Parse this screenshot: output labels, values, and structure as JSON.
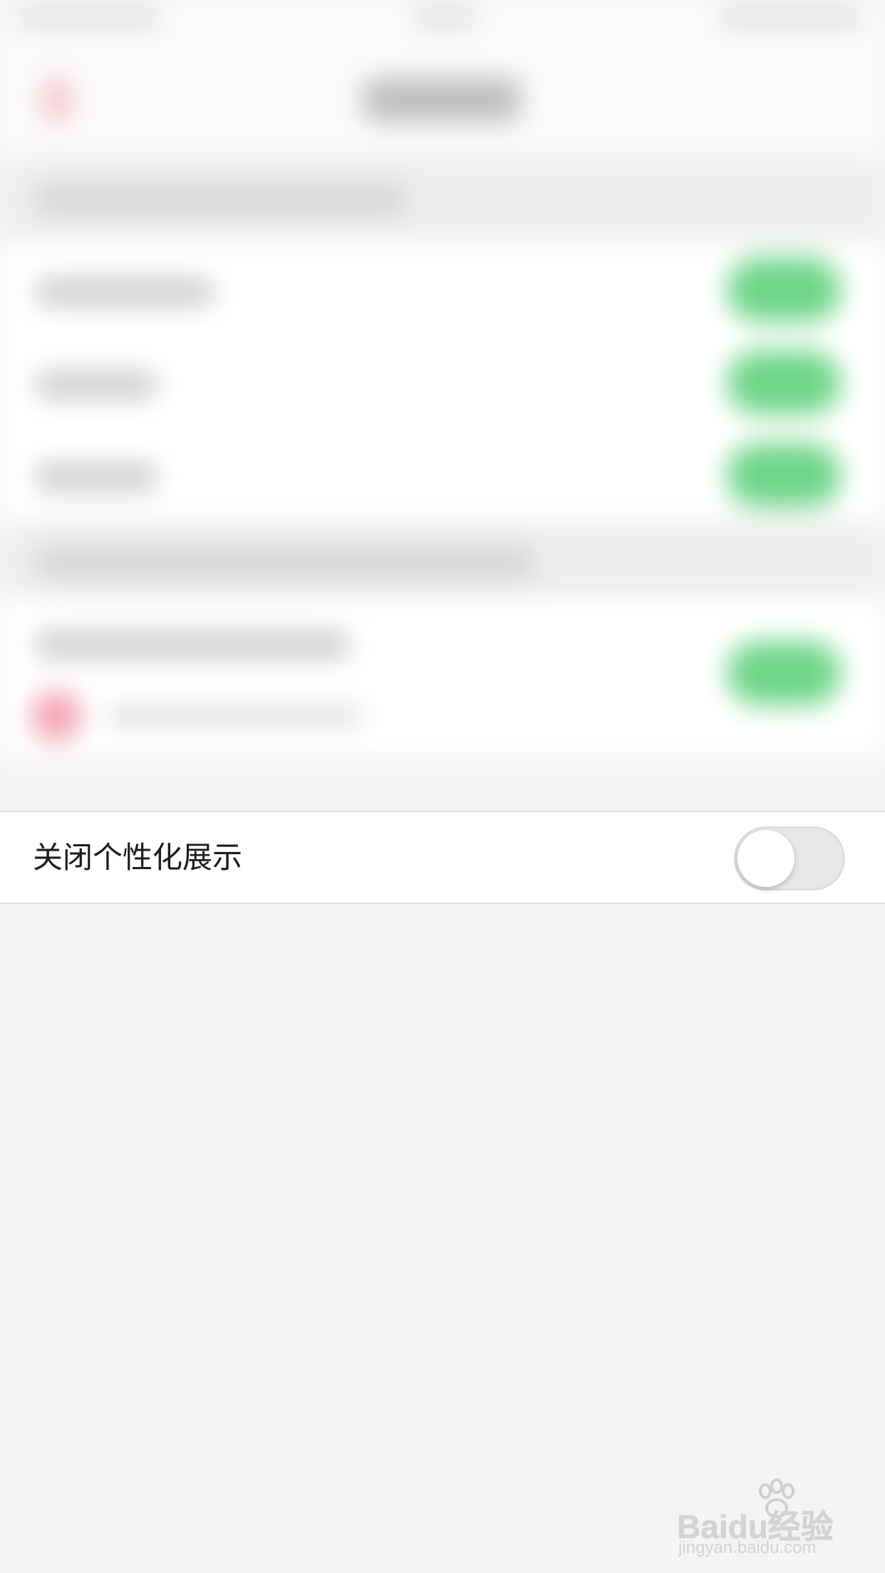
{
  "settings": {
    "personalization_label": "关闭个性化展示",
    "personalization_toggle_on": false
  },
  "watermark": {
    "brand": "Baidu经验",
    "url": "jingyan.baidu.com"
  },
  "colors": {
    "background": "#f4f4f4",
    "row_background": "#ffffff",
    "toggle_off": "#e8e8e8",
    "toggle_on_blurred": "#6fd68a",
    "accent_red_blurred": "#f3a2b3"
  }
}
